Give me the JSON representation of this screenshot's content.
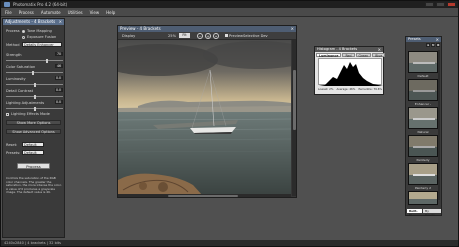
{
  "window": {
    "title": "Photomatix Pro 4.2 (64-bit)"
  },
  "menu": [
    "File",
    "Process",
    "Automate",
    "Utilities",
    "View",
    "Help"
  ],
  "adjustments": {
    "title": "Adjustments - 4 Brackets",
    "process_label": "Process",
    "tone_mapping": "Tone Mapping",
    "exposure_fusion": "Exposure Fusion",
    "method_label": "Method",
    "method_value": "Details Enhancer",
    "sliders": [
      {
        "label": "Strength",
        "value": "70"
      },
      {
        "label": "Color Saturation",
        "value": "46"
      },
      {
        "label": "Luminosity",
        "value": "0.0"
      },
      {
        "label": "Detail Contrast",
        "value": "0.0"
      },
      {
        "label": "Lighting Adjustments",
        "value": "0.0"
      }
    ],
    "lighting_effects": "Lighting Effects Mode",
    "show_more": "Show More Options",
    "show_advanced": "Show Advanced Options",
    "reset_label": "Reset:",
    "reset_value": "Default",
    "presets_label": "Presets:",
    "presets_value": "Default",
    "process_button": "Process",
    "help_text": "Controls the saturation of the RGB color channels. The greater the saturation, the more intense the color. A value of 0 produces a grayscale image. The default value is 46."
  },
  "preview": {
    "title": "Preview - 4 Brackets",
    "display_label": "Display",
    "zoom_value": "25%",
    "zoom_btn": "Fit",
    "preview_check": "Preview",
    "selective_label": "Selective Dev"
  },
  "histogram": {
    "title": "Histogram - 4 Brackets",
    "tabs": [
      "Luminance",
      "Red",
      "Green",
      "Blue"
    ],
    "stats": [
      "Lowest: 2%",
      "Average: 46%",
      "Percentile: 79.6%"
    ]
  },
  "presets": {
    "title": "Presets",
    "items": [
      {
        "label": "Default"
      },
      {
        "label": "Enhancer - Painterly"
      },
      {
        "label": "Natural"
      },
      {
        "label": "Painterly"
      },
      {
        "label": "Painterly 2"
      },
      {
        "label": "Painterly 3"
      }
    ],
    "tabs": [
      "Built-In",
      "My Presets"
    ]
  },
  "status": {
    "text": "4240x2840 | 4 brackets | 32 bits"
  },
  "colors": {
    "titlebar": "#1f1f1f",
    "panel": "#3a3a3a",
    "panel_title": "#5a6e8a",
    "workspace": "#505050"
  }
}
